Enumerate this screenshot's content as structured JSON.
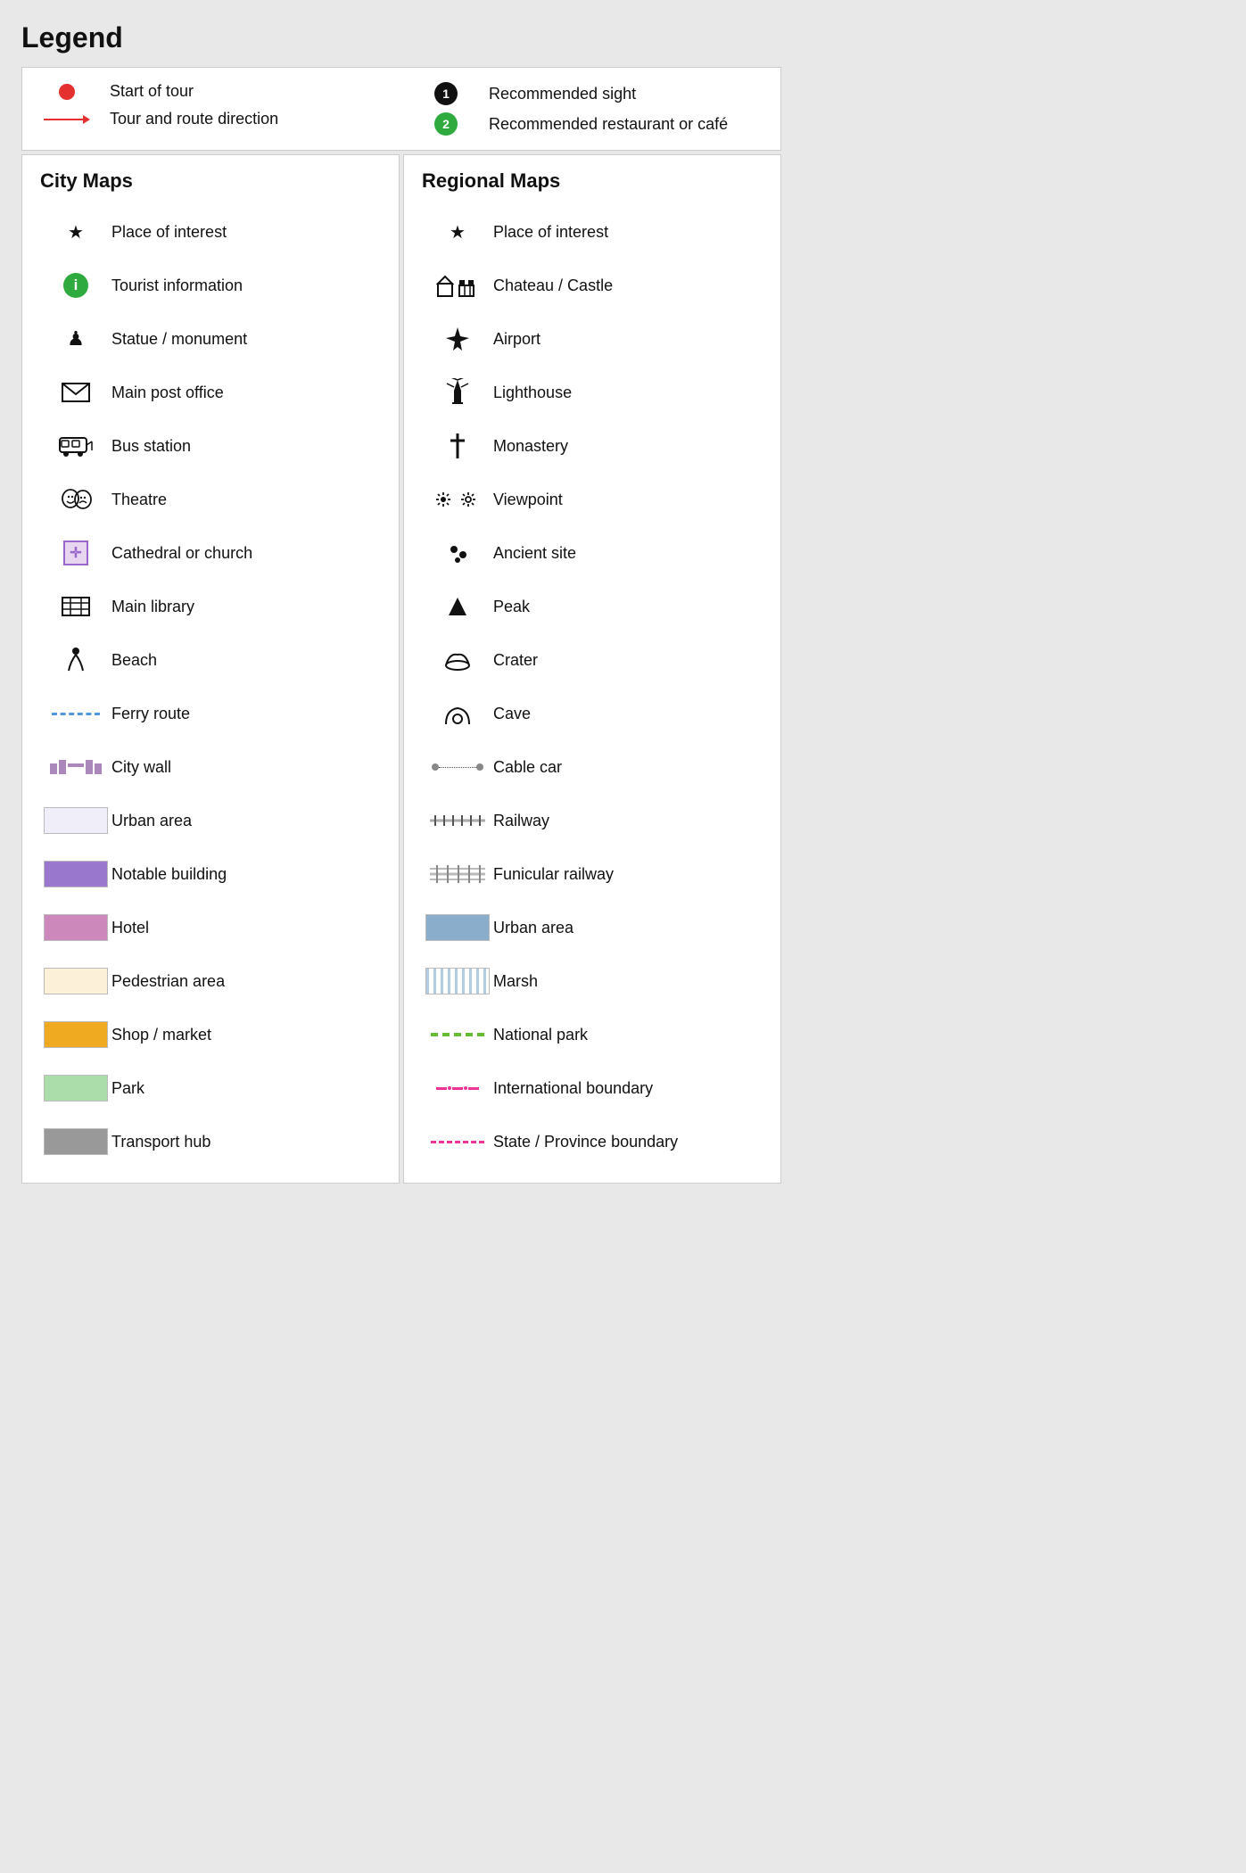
{
  "title": "Legend",
  "top": {
    "left": [
      {
        "icon": "red-dot",
        "label": "Start of tour"
      },
      {
        "icon": "red-arrow",
        "label": "Tour and route direction"
      }
    ],
    "right": [
      {
        "icon": "black-circle-1",
        "label": "Recommended sight"
      },
      {
        "icon": "green-circle-2",
        "label": "Recommended restaurant or café"
      }
    ]
  },
  "city": {
    "title": "City Maps",
    "items": [
      {
        "icon": "star",
        "label": "Place of interest"
      },
      {
        "icon": "green-info",
        "label": "Tourist information"
      },
      {
        "icon": "statue",
        "label": "Statue / monument"
      },
      {
        "icon": "envelope",
        "label": "Main post office"
      },
      {
        "icon": "bus",
        "label": "Bus station"
      },
      {
        "icon": "theatre",
        "label": "Theatre"
      },
      {
        "icon": "church",
        "label": "Cathedral or church"
      },
      {
        "icon": "library",
        "label": "Main library"
      },
      {
        "icon": "beach",
        "label": "Beach"
      },
      {
        "icon": "ferry",
        "label": "Ferry route"
      },
      {
        "icon": "citywall",
        "label": "City wall"
      },
      {
        "icon": "urban-rect",
        "label": "Urban area",
        "color": "urban-light"
      },
      {
        "icon": "color-rect",
        "label": "Notable building",
        "color": "notable-purple"
      },
      {
        "icon": "color-rect",
        "label": "Hotel",
        "color": "hotel-pink"
      },
      {
        "icon": "color-rect",
        "label": "Pedestrian area",
        "color": "pedestrian-cream"
      },
      {
        "icon": "color-rect",
        "label": "Shop / market",
        "color": "shop-orange"
      },
      {
        "icon": "color-rect",
        "label": "Park",
        "color": "park-green"
      },
      {
        "icon": "color-rect",
        "label": "Transport hub",
        "color": "transport-gray"
      }
    ]
  },
  "regional": {
    "title": "Regional Maps",
    "items": [
      {
        "icon": "star",
        "label": "Place of interest"
      },
      {
        "icon": "castle",
        "label": "Chateau / Castle"
      },
      {
        "icon": "airport",
        "label": "Airport"
      },
      {
        "icon": "lighthouse",
        "label": "Lighthouse"
      },
      {
        "icon": "monastery",
        "label": "Monastery"
      },
      {
        "icon": "viewpoint",
        "label": "Viewpoint"
      },
      {
        "icon": "ancient",
        "label": "Ancient site"
      },
      {
        "icon": "peak",
        "label": "Peak"
      },
      {
        "icon": "crater",
        "label": "Crater"
      },
      {
        "icon": "cave",
        "label": "Cave"
      },
      {
        "icon": "cablecar",
        "label": "Cable car"
      },
      {
        "icon": "railway",
        "label": "Railway"
      },
      {
        "icon": "funicular",
        "label": "Funicular railway"
      },
      {
        "icon": "urban-blue-rect",
        "label": "Urban area",
        "color": "urban-blue"
      },
      {
        "icon": "marsh",
        "label": "Marsh"
      },
      {
        "icon": "national-park",
        "label": "National park"
      },
      {
        "icon": "intl-boundary",
        "label": "International boundary"
      },
      {
        "icon": "state-boundary",
        "label": "State / Province boundary"
      }
    ]
  }
}
